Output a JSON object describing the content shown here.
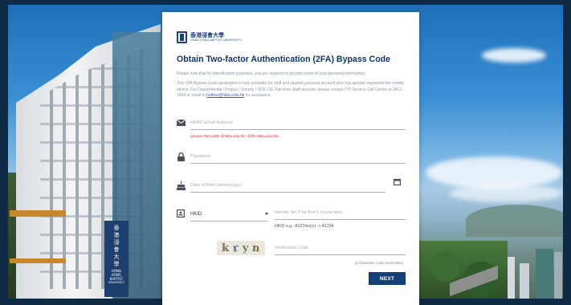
{
  "background": {
    "sign_lines": [
      "香",
      "港",
      "浸",
      "會",
      "大",
      "學",
      "HONG",
      "KONG",
      "BAPTIST",
      "UNIVERSITY"
    ]
  },
  "logo": {
    "chinese": "香港浸會大學",
    "english": "HONG KONG BAPTIST UNIVERSITY"
  },
  "page": {
    "title": "Obtain Two-factor Authentication (2FA) Bypass Code",
    "note": "Please note that for identification purposes, you are required to provide some of your personal information.",
    "info_before_email": "This 2FA Bypass Code generation is only available for staff and student personal account who has already registered the mobile device. For Departmental / Project / Society / SCE CIE Part-time Staff account, please contact ITO Service Call Centre at 3411-7899 or email to ",
    "info_email": "hotline@hkbu.edu.hk",
    "info_after_email": " for assistance."
  },
  "form": {
    "email_placeholder": "HKBU Email Address",
    "email_hint_prefix": "(please INCLUDE ",
    "email_hint_domains": "@hkbu.edu.hk / @life.hkbu.edu.hk",
    "email_hint_suffix": ")",
    "password_placeholder": "Password",
    "dob_placeholder": "Date of Birth (ddmmyyyy)",
    "id_type_selected": "HKID",
    "id_no_placeholder": "Identity No (The first 5 characters)",
    "hkid_example": "HKID e.g.: A1234xx(x) -> A1234",
    "captcha_chars": [
      "k",
      "r",
      "y",
      "n"
    ],
    "verification_placeholder": "Verification Code",
    "case_hint": "(4-Character, Case-insensitive)",
    "next_label": "NEXT"
  },
  "icons": {
    "email": "envelope-icon",
    "password": "lock-icon",
    "dob": "cake-icon",
    "calendar": "calendar-icon",
    "id_type": "id-card-icon"
  },
  "colors": {
    "primary": "#153f78",
    "title": "#0f3566",
    "hint_red": "#d9262b",
    "link": "#2a62c8"
  }
}
